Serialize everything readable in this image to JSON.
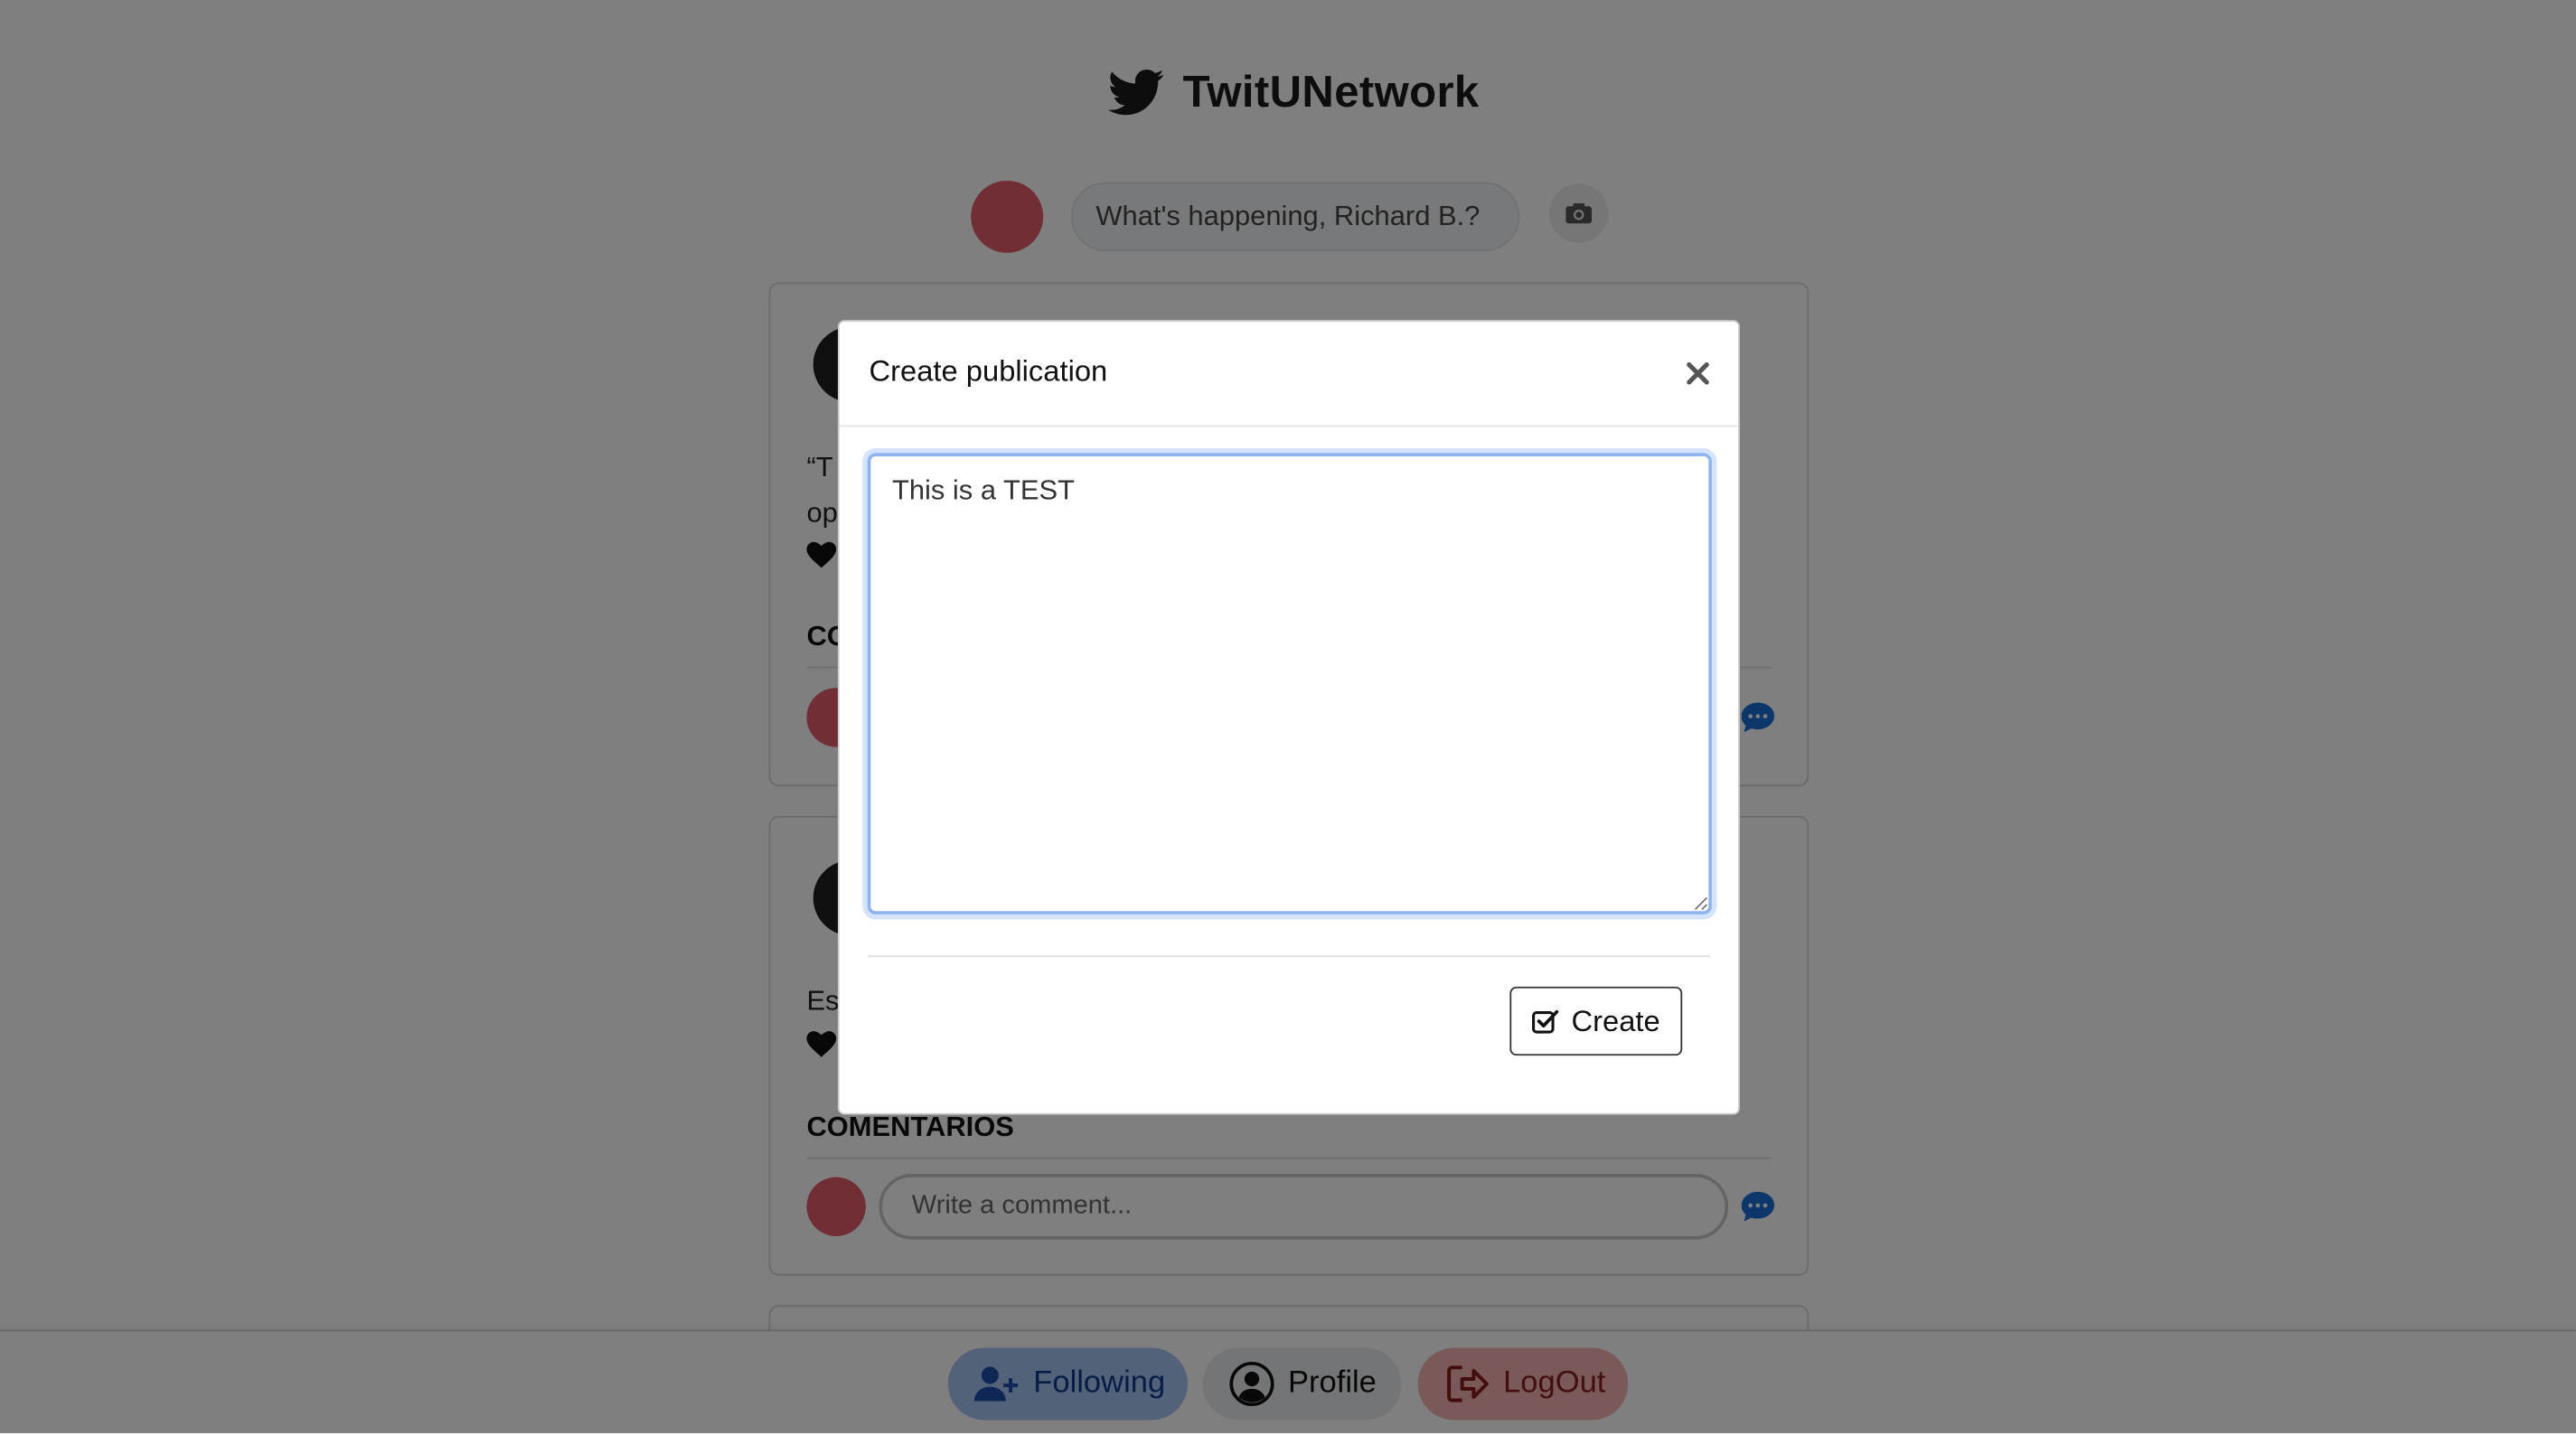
{
  "app": {
    "brand_title": "TwitUNetwork"
  },
  "composer": {
    "placeholder": "What's happening, Richard B.?"
  },
  "feed": {
    "posts": [
      {
        "text_line1": "“T",
        "text_line2": "op",
        "comments_title": "CO"
      },
      {
        "text_line1": "Es",
        "comments_title": "COMENTARIOS",
        "comment_placeholder": "Write a comment..."
      }
    ]
  },
  "bottom_nav": {
    "following": "Following",
    "profile": "Profile",
    "logout": "LogOut"
  },
  "modal": {
    "title": "Create publication",
    "textarea_value": "This is a TEST",
    "create_label": "Create"
  },
  "colors": {
    "avatar_red": "#e35d6a",
    "send_blue": "#1a6fd6",
    "focus_blue": "#8fb4f0"
  },
  "icons": {
    "brand": "twitter-bird-icon",
    "camera": "camera-icon",
    "heart": "heart-icon",
    "send": "comment-bubble-icon",
    "following": "user-plus-icon",
    "profile": "user-circle-icon",
    "logout": "sign-out-icon",
    "close": "close-icon",
    "create": "check-square-icon"
  }
}
